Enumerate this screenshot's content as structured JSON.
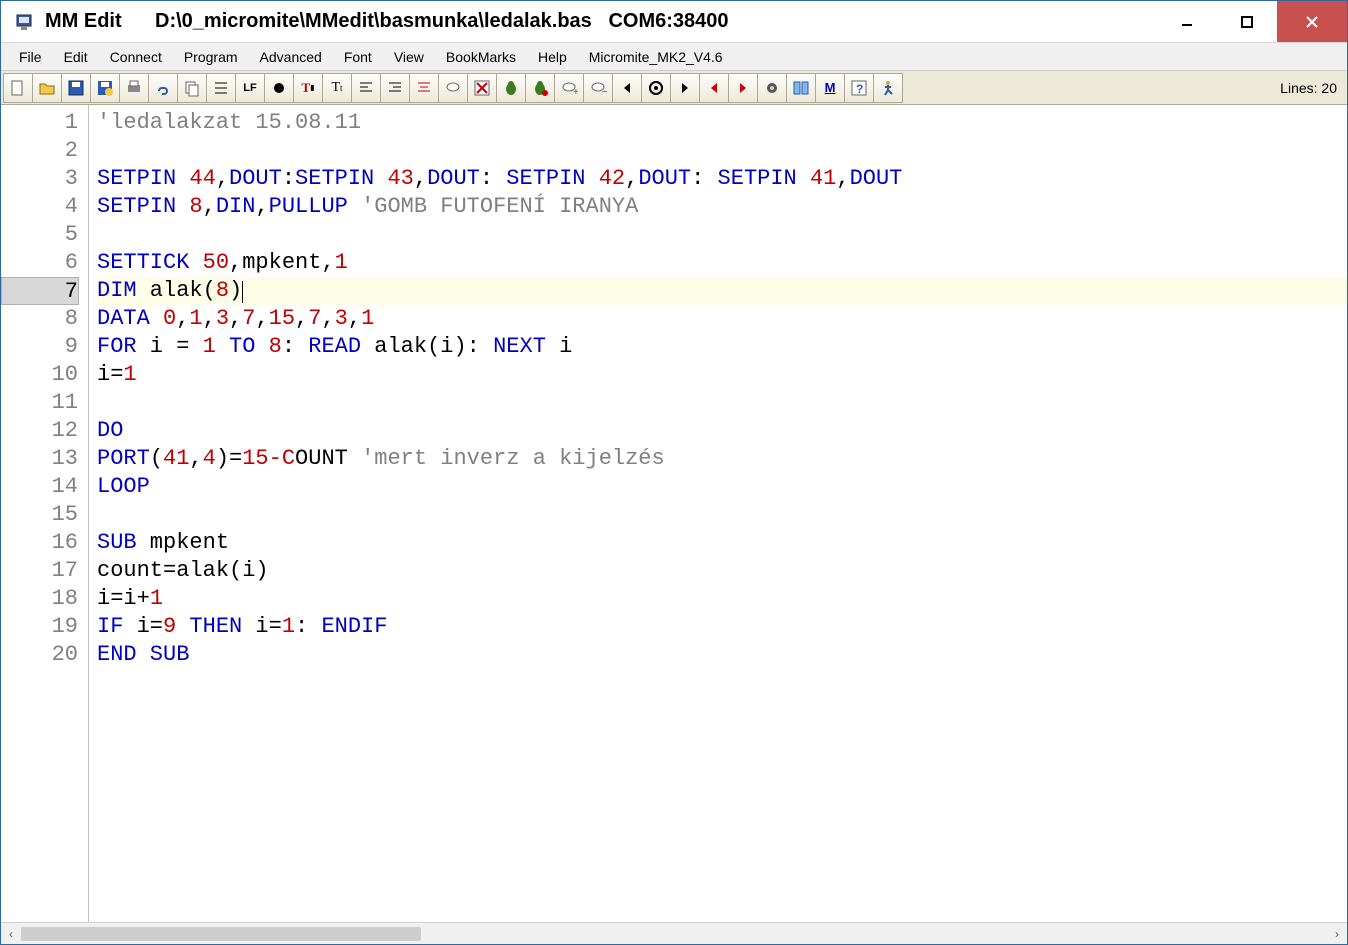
{
  "title": {
    "app": "MM Edit",
    "path": "D:\\0_micromite\\MMedit\\basmunka\\ledalak.bas",
    "port": "COM6:38400"
  },
  "menu": {
    "items": [
      "File",
      "Edit",
      "Connect",
      "Program",
      "Advanced",
      "Font",
      "View",
      "BookMarks",
      "Help",
      "Micromite_MK2_V4.6"
    ]
  },
  "toolbar": {
    "buttons": [
      "new-file",
      "open-file",
      "save-file",
      "save-as",
      "print",
      "link",
      "copy",
      "list",
      "lf",
      "record",
      "color-text",
      "text-size",
      "align-left",
      "align-right",
      "align-center-red",
      "comment",
      "delete-x",
      "bug-green",
      "bug-green2",
      "chat-add",
      "chat-remove",
      "arrow-left",
      "target",
      "arrow-right",
      "arrow-left-red",
      "arrow-right-red",
      "gear",
      "columns",
      "m-logo",
      "help",
      "run-man"
    ],
    "lines_label": "Lines: 20"
  },
  "editor": {
    "current_line": 7,
    "lines": [
      {
        "n": 1,
        "tokens": [
          {
            "c": "com",
            "t": "'ledalakzat 15.08.11"
          }
        ]
      },
      {
        "n": 2,
        "tokens": []
      },
      {
        "n": 3,
        "tokens": [
          {
            "c": "kw",
            "t": "SETPIN "
          },
          {
            "c": "num",
            "t": "44"
          },
          {
            "c": "txt",
            "t": ","
          },
          {
            "c": "kw",
            "t": "DOUT"
          },
          {
            "c": "txt",
            "t": ":"
          },
          {
            "c": "kw",
            "t": "SETPIN "
          },
          {
            "c": "num",
            "t": "43"
          },
          {
            "c": "txt",
            "t": ","
          },
          {
            "c": "kw",
            "t": "DOUT"
          },
          {
            "c": "txt",
            "t": ": "
          },
          {
            "c": "kw",
            "t": "SETPIN "
          },
          {
            "c": "num",
            "t": "42"
          },
          {
            "c": "txt",
            "t": ","
          },
          {
            "c": "kw",
            "t": "DOUT"
          },
          {
            "c": "txt",
            "t": ": "
          },
          {
            "c": "kw",
            "t": "SETPIN "
          },
          {
            "c": "num",
            "t": "41"
          },
          {
            "c": "txt",
            "t": ","
          },
          {
            "c": "kw",
            "t": "DOUT"
          }
        ]
      },
      {
        "n": 4,
        "tokens": [
          {
            "c": "kw",
            "t": "SETPIN "
          },
          {
            "c": "num",
            "t": "8"
          },
          {
            "c": "txt",
            "t": ","
          },
          {
            "c": "kw",
            "t": "DIN"
          },
          {
            "c": "txt",
            "t": ","
          },
          {
            "c": "kw",
            "t": "PULLUP "
          },
          {
            "c": "com",
            "t": "'GOMB FUTOFENÍ IRANYA"
          }
        ]
      },
      {
        "n": 5,
        "tokens": []
      },
      {
        "n": 6,
        "tokens": [
          {
            "c": "kw",
            "t": "SETTICK "
          },
          {
            "c": "num",
            "t": "50"
          },
          {
            "c": "txt",
            "t": ",mpkent,"
          },
          {
            "c": "num",
            "t": "1"
          }
        ]
      },
      {
        "n": 7,
        "tokens": [
          {
            "c": "kw",
            "t": "DIM"
          },
          {
            "c": "txt",
            "t": " alak("
          },
          {
            "c": "num",
            "t": "8"
          },
          {
            "c": "txt",
            "t": ")"
          }
        ],
        "cursor": true
      },
      {
        "n": 8,
        "tokens": [
          {
            "c": "kw",
            "t": "DATA "
          },
          {
            "c": "num",
            "t": "0"
          },
          {
            "c": "txt",
            "t": ","
          },
          {
            "c": "num",
            "t": "1"
          },
          {
            "c": "txt",
            "t": ","
          },
          {
            "c": "num",
            "t": "3"
          },
          {
            "c": "txt",
            "t": ","
          },
          {
            "c": "num",
            "t": "7"
          },
          {
            "c": "txt",
            "t": ","
          },
          {
            "c": "num",
            "t": "15"
          },
          {
            "c": "txt",
            "t": ","
          },
          {
            "c": "num",
            "t": "7"
          },
          {
            "c": "txt",
            "t": ","
          },
          {
            "c": "num",
            "t": "3"
          },
          {
            "c": "txt",
            "t": ","
          },
          {
            "c": "num",
            "t": "1"
          }
        ]
      },
      {
        "n": 9,
        "tokens": [
          {
            "c": "kw",
            "t": "FOR"
          },
          {
            "c": "txt",
            "t": " i = "
          },
          {
            "c": "num",
            "t": "1"
          },
          {
            "c": "kw",
            "t": " TO "
          },
          {
            "c": "num",
            "t": "8"
          },
          {
            "c": "txt",
            "t": ": "
          },
          {
            "c": "kw",
            "t": "READ"
          },
          {
            "c": "txt",
            "t": " alak(i): "
          },
          {
            "c": "kw",
            "t": "NEXT"
          },
          {
            "c": "txt",
            "t": " i"
          }
        ]
      },
      {
        "n": 10,
        "tokens": [
          {
            "c": "txt",
            "t": "i="
          },
          {
            "c": "num",
            "t": "1"
          }
        ]
      },
      {
        "n": 11,
        "tokens": []
      },
      {
        "n": 12,
        "tokens": [
          {
            "c": "kw",
            "t": "DO"
          }
        ]
      },
      {
        "n": 13,
        "tokens": [
          {
            "c": "kw",
            "t": "PORT"
          },
          {
            "c": "txt",
            "t": "("
          },
          {
            "c": "num",
            "t": "41"
          },
          {
            "c": "txt",
            "t": ","
          },
          {
            "c": "num",
            "t": "4"
          },
          {
            "c": "txt",
            "t": ")="
          },
          {
            "c": "num",
            "t": "15-C"
          },
          {
            "c": "txt",
            "t": "OUNT "
          },
          {
            "c": "com",
            "t": "'mert inverz a kijelzés"
          }
        ]
      },
      {
        "n": 14,
        "tokens": [
          {
            "c": "kw",
            "t": "LOOP"
          }
        ]
      },
      {
        "n": 15,
        "tokens": []
      },
      {
        "n": 16,
        "tokens": [
          {
            "c": "kw",
            "t": "SUB"
          },
          {
            "c": "txt",
            "t": " mpkent"
          }
        ]
      },
      {
        "n": 17,
        "tokens": [
          {
            "c": "txt",
            "t": "count=alak(i)"
          }
        ]
      },
      {
        "n": 18,
        "tokens": [
          {
            "c": "txt",
            "t": "i=i+"
          },
          {
            "c": "num",
            "t": "1"
          }
        ]
      },
      {
        "n": 19,
        "tokens": [
          {
            "c": "kw",
            "t": "IF"
          },
          {
            "c": "txt",
            "t": " i="
          },
          {
            "c": "num",
            "t": "9"
          },
          {
            "c": "kw",
            "t": " THEN"
          },
          {
            "c": "txt",
            "t": " i="
          },
          {
            "c": "num",
            "t": "1"
          },
          {
            "c": "txt",
            "t": ": "
          },
          {
            "c": "kw",
            "t": "ENDIF"
          }
        ]
      },
      {
        "n": 20,
        "tokens": [
          {
            "c": "kw",
            "t": "END SUB"
          }
        ]
      }
    ]
  }
}
